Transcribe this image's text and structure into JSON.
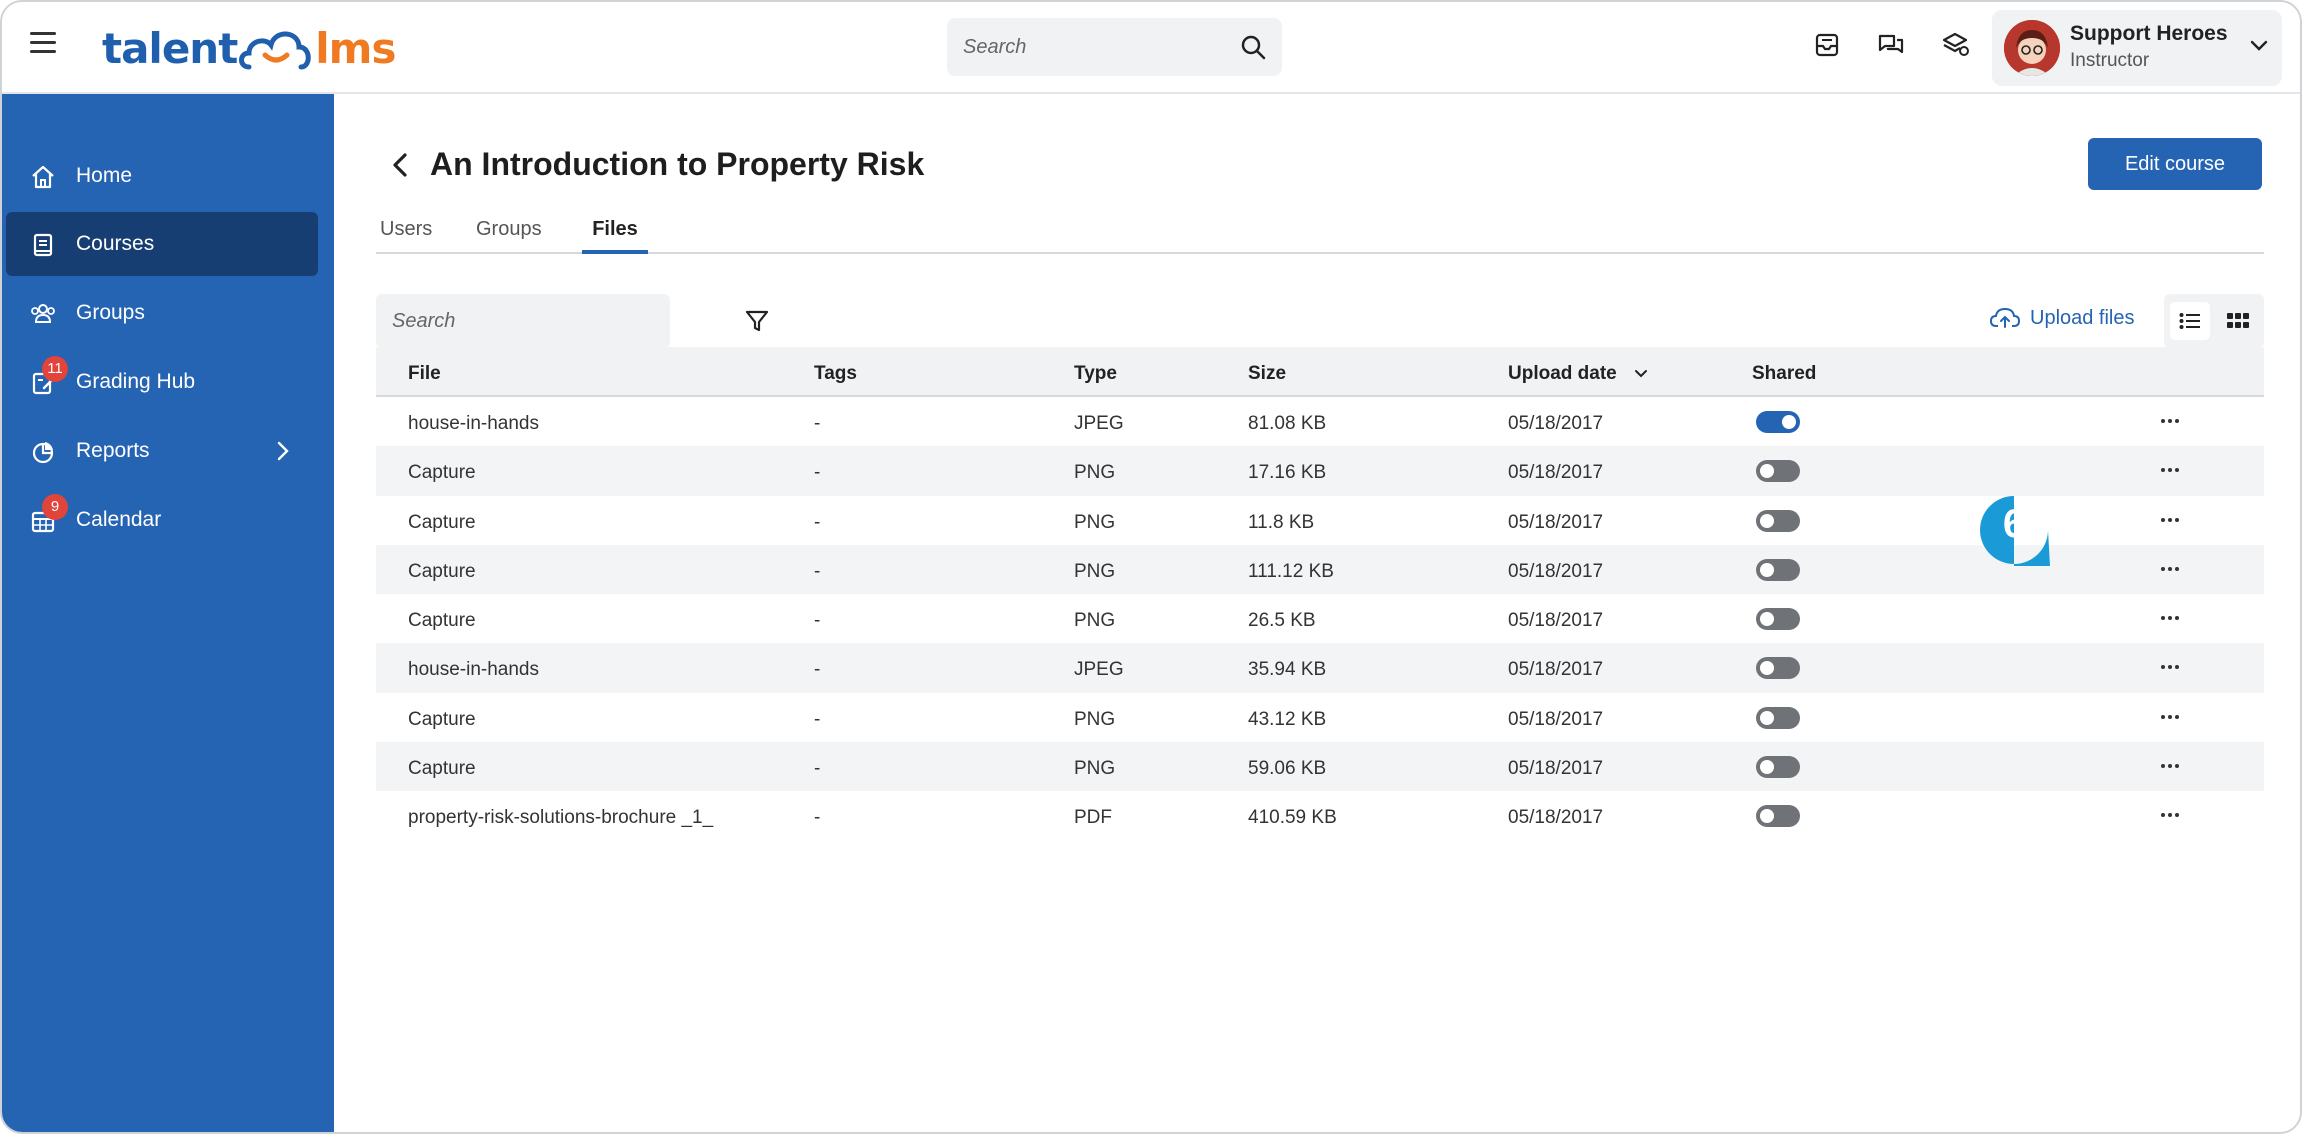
{
  "app": {
    "logo_part1": "talent",
    "logo_part2": "lms",
    "search_placeholder": "Search",
    "accent_color": "#2563b3",
    "logo_orange": "#f07a22"
  },
  "user": {
    "name": "Support Heroes",
    "role": "Instructor"
  },
  "sidebar": {
    "items": [
      {
        "label": "Home",
        "icon": "home-icon"
      },
      {
        "label": "Courses",
        "icon": "book-icon"
      },
      {
        "label": "Groups",
        "icon": "users-icon"
      },
      {
        "label": "Grading Hub",
        "icon": "grading-icon",
        "badge": "11"
      },
      {
        "label": "Reports",
        "icon": "pie-chart-icon"
      },
      {
        "label": "Calendar",
        "icon": "calendar-icon",
        "badge": "9"
      }
    ]
  },
  "page": {
    "title": "An Introduction to Property Risk",
    "edit_button": "Edit course",
    "tabs": [
      "Users",
      "Groups",
      "Files"
    ],
    "active_tab": "Files",
    "files_search_placeholder": "Search",
    "upload_label": "Upload files"
  },
  "table": {
    "headers": [
      "File",
      "Tags",
      "Type",
      "Size",
      "Upload date",
      "Shared"
    ],
    "rows": [
      {
        "file": "house-in-hands",
        "tags": "-",
        "type": "JPEG",
        "size": "81.08 KB",
        "date": "05/18/2017",
        "shared": true
      },
      {
        "file": "Capture",
        "tags": "-",
        "type": "PNG",
        "size": "17.16 KB",
        "date": "05/18/2017",
        "shared": false
      },
      {
        "file": "Capture",
        "tags": "-",
        "type": "PNG",
        "size": "11.8 KB",
        "date": "05/18/2017",
        "shared": false
      },
      {
        "file": "Capture",
        "tags": "-",
        "type": "PNG",
        "size": "111.12 KB",
        "date": "05/18/2017",
        "shared": false
      },
      {
        "file": "Capture",
        "tags": "-",
        "type": "PNG",
        "size": "26.5 KB",
        "date": "05/18/2017",
        "shared": false
      },
      {
        "file": "house-in-hands",
        "tags": "-",
        "type": "JPEG",
        "size": "35.94 KB",
        "date": "05/18/2017",
        "shared": false
      },
      {
        "file": "Capture",
        "tags": "-",
        "type": "PNG",
        "size": "43.12 KB",
        "date": "05/18/2017",
        "shared": false
      },
      {
        "file": "Capture",
        "tags": "-",
        "type": "PNG",
        "size": "59.06 KB",
        "date": "05/18/2017",
        "shared": false
      },
      {
        "file": "property-risk-solutions-brochure _1_",
        "tags": "-",
        "type": "PDF",
        "size": "410.59 KB",
        "date": "05/18/2017",
        "shared": false
      }
    ]
  },
  "annotation": {
    "step_number": "6",
    "color": "#1a9bd7"
  }
}
